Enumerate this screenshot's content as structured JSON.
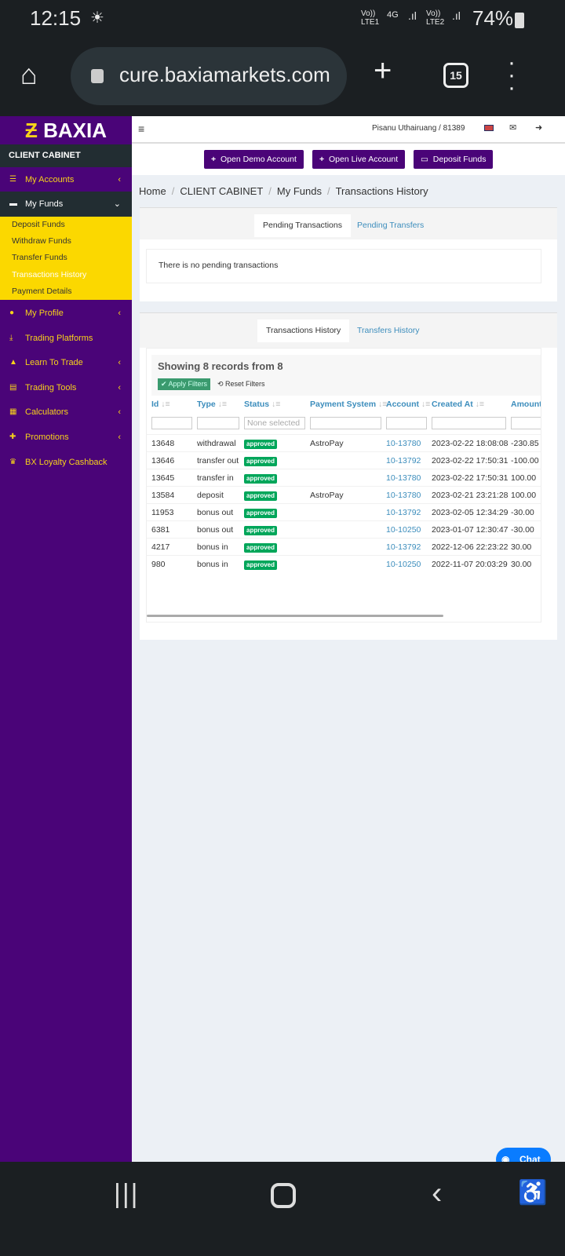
{
  "status_bar": {
    "time": "12:15",
    "sim1": "Vo)) LTE1",
    "network": "4G",
    "sim2": "Vo)) LTE2",
    "battery": "74%"
  },
  "browser": {
    "url": "cure.baxiamarkets.com",
    "tab_count": "15"
  },
  "sidebar": {
    "brand": "BAXIA",
    "section": "CLIENT CABINET",
    "items": [
      {
        "label": "My Accounts",
        "icon": "list-icon",
        "chev": "‹"
      },
      {
        "label": "My Funds",
        "icon": "wallet-icon",
        "chev": "⌄"
      }
    ],
    "sub_items": [
      "Deposit Funds",
      "Withdraw Funds",
      "Transfer Funds",
      "Transactions History",
      "Payment Details"
    ],
    "items2": [
      {
        "label": "My Profile",
        "chev": "‹"
      },
      {
        "label": "Trading Platforms",
        "chev": ""
      },
      {
        "label": "Learn To Trade",
        "chev": "‹"
      },
      {
        "label": "Trading Tools",
        "chev": "‹"
      },
      {
        "label": "Calculators",
        "chev": "‹"
      },
      {
        "label": "Promotions",
        "chev": "‹"
      },
      {
        "label": "BX Loyalty Cashback",
        "chev": ""
      }
    ]
  },
  "topbar": {
    "menu": "≡",
    "user": "Pisanu Uthairuang / 81389"
  },
  "buttons": {
    "demo": "Open Demo Account",
    "live": "Open Live Account",
    "deposit": "Deposit Funds"
  },
  "breadcrumb": [
    "Home",
    "CLIENT CABINET",
    "My Funds",
    "Transactions History"
  ],
  "pending": {
    "tabs": [
      "Pending Transactions",
      "Pending Transfers"
    ],
    "empty": "There is no pending transactions"
  },
  "history": {
    "tabs": [
      "Transactions History",
      "Transfers History"
    ],
    "summary": "Showing 8 records from 8",
    "apply": "Apply Filters",
    "reset": "Reset Filters",
    "columns": [
      "Id",
      "Type",
      "Status",
      "Payment System",
      "Account",
      "Created At",
      "Amount"
    ],
    "status_placeholder": "None selected",
    "rows": [
      [
        "13648",
        "withdrawal",
        "approved",
        "AstroPay",
        "10-13780",
        "2023-02-22 18:08:08",
        "-230.85"
      ],
      [
        "13646",
        "transfer out",
        "approved",
        "",
        "10-13792",
        "2023-02-22 17:50:31",
        "-100.00"
      ],
      [
        "13645",
        "transfer in",
        "approved",
        "",
        "10-13780",
        "2023-02-22 17:50:31",
        "100.00"
      ],
      [
        "13584",
        "deposit",
        "approved",
        "AstroPay",
        "10-13780",
        "2023-02-21 23:21:28",
        "100.00"
      ],
      [
        "11953",
        "bonus out",
        "approved",
        "",
        "10-13792",
        "2023-02-05 12:34:29",
        "-30.00"
      ],
      [
        "6381",
        "bonus out",
        "approved",
        "",
        "10-10250",
        "2023-01-07 12:30:47",
        "-30.00"
      ],
      [
        "4217",
        "bonus in",
        "approved",
        "",
        "10-13792",
        "2022-12-06 22:23:22",
        "30.00"
      ],
      [
        "980",
        "bonus in",
        "approved",
        "",
        "10-10250",
        "2022-11-07 20:03:29",
        "30.00"
      ]
    ]
  },
  "chat": {
    "label": "Chat"
  }
}
